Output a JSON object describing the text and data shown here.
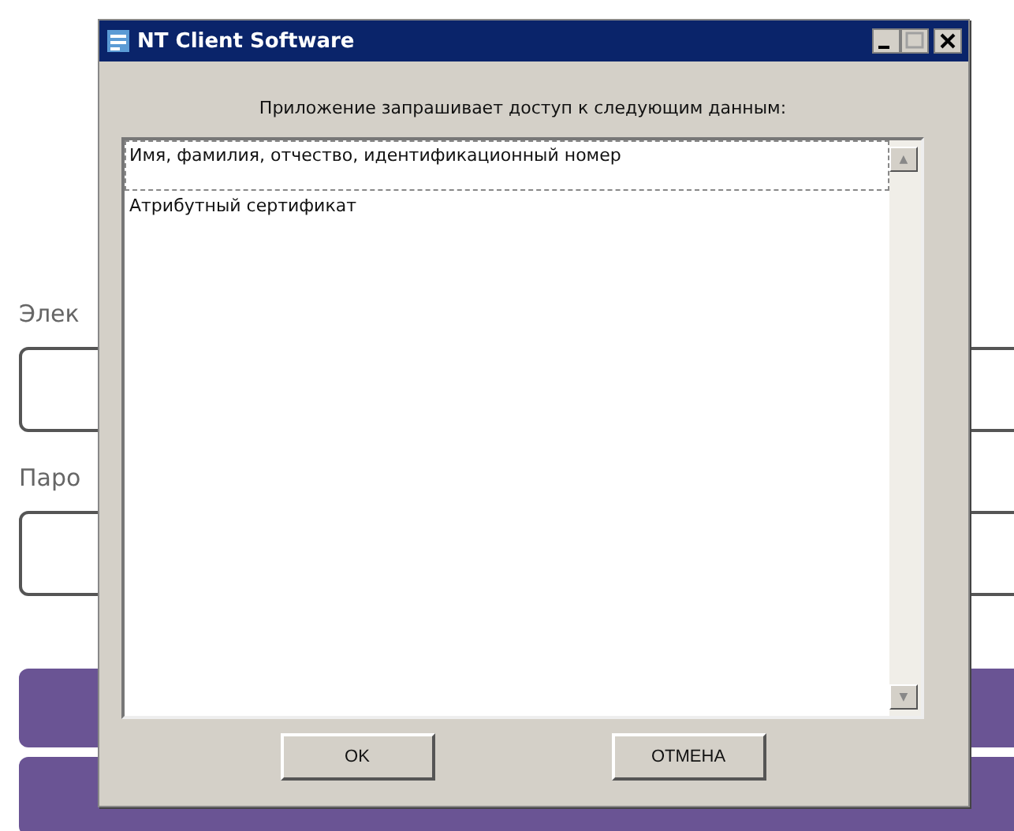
{
  "page": {
    "fields": [
      {
        "label": "Элек"
      },
      {
        "label": "Паро"
      }
    ],
    "actions": [
      {
        "kind": "primary"
      },
      {
        "kind": "primary"
      }
    ]
  },
  "dialog": {
    "title": "NT Client Software",
    "message": "Приложение запрашивает доступ к следующим данным:",
    "items": [
      {
        "text": "Имя, фамилия, отчество, идентификационный номер",
        "selected": true
      },
      {
        "text": "Атрибутный сертификат",
        "selected": false
      }
    ],
    "scroll_up": "▲",
    "scroll_down": "▼",
    "buttons": [
      "OK",
      "ОТМЕНА"
    ]
  }
}
